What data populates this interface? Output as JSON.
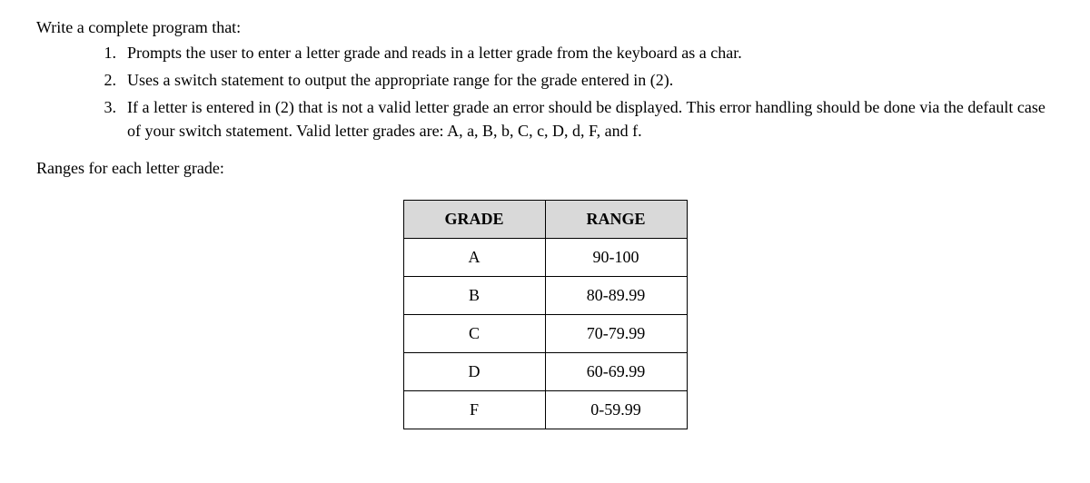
{
  "intro": "Write a complete program that:",
  "list": [
    {
      "num": "1.",
      "text": "Prompts the user to enter a letter grade and reads in a letter grade from the keyboard as a char."
    },
    {
      "num": "2.",
      "text": "Uses a switch statement to output the appropriate range for the grade entered in (2)."
    },
    {
      "num": "3.",
      "text": "If a letter is entered in (2) that is not a valid letter grade an error should be displayed. This error handling should be done via the default case of your switch statement. Valid letter grades are: A, a, B, b, C, c, D, d, F, and f."
    }
  ],
  "ranges_label": "Ranges for each letter grade:",
  "table": {
    "headers": {
      "grade": "GRADE",
      "range": "RANGE"
    },
    "rows": [
      {
        "grade": "A",
        "range": "90-100"
      },
      {
        "grade": "B",
        "range": "80-89.99"
      },
      {
        "grade": "C",
        "range": "70-79.99"
      },
      {
        "grade": "D",
        "range": "60-69.99"
      },
      {
        "grade": "F",
        "range": "0-59.99"
      }
    ]
  },
  "chart_data": {
    "type": "table",
    "title": "Ranges for each letter grade",
    "columns": [
      "GRADE",
      "RANGE"
    ],
    "rows": [
      [
        "A",
        "90-100"
      ],
      [
        "B",
        "80-89.99"
      ],
      [
        "C",
        "70-79.99"
      ],
      [
        "D",
        "60-69.99"
      ],
      [
        "F",
        "0-59.99"
      ]
    ]
  }
}
